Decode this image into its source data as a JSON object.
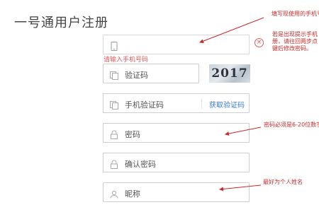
{
  "page": {
    "title": "一号通用户注册"
  },
  "form": {
    "phone": {
      "placeholder": "",
      "error": "请输入手机号码"
    },
    "captcha": {
      "placeholder": "验证码",
      "image_text": "2017"
    },
    "sms": {
      "placeholder": "手机验证码",
      "button": "获取验证码"
    },
    "password": {
      "placeholder": "密码"
    },
    "confirm": {
      "placeholder": "确认密码"
    },
    "nickname": {
      "placeholder": "昵称"
    }
  },
  "annotations": {
    "phone_note": "填写现使用的手机号",
    "hint_note_line1": "若是出现提示手机",
    "hint_note_line2": "册，请往回两步点",
    "hint_note_line3": "键后修改密码。",
    "password_note": "密码必须是6-20位数字",
    "nickname_note": "最好为个人姓名"
  },
  "colors": {
    "accent": "#3a7bd5",
    "error": "#e05a5a",
    "annotation": "#cc2a2a"
  }
}
